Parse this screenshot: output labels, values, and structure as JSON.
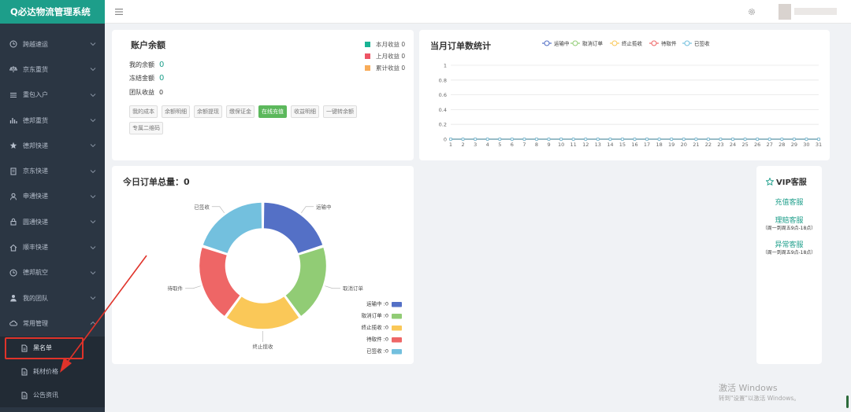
{
  "app": {
    "title": "Q必达物流管理系统"
  },
  "sidebar": {
    "items": [
      {
        "label": "跨越速运",
        "icon": "clock-icon"
      },
      {
        "label": "京东重货",
        "icon": "scale-icon"
      },
      {
        "label": "重包入户",
        "icon": "list-icon"
      },
      {
        "label": "德邦重货",
        "icon": "bar-chart-icon"
      },
      {
        "label": "德邦快递",
        "icon": "star-icon"
      },
      {
        "label": "京东快递",
        "icon": "document-icon"
      },
      {
        "label": "申通快递",
        "icon": "user-icon"
      },
      {
        "label": "圆通快递",
        "icon": "lock-icon"
      },
      {
        "label": "顺丰快递",
        "icon": "home-icon"
      },
      {
        "label": "德邦航空",
        "icon": "clock-icon"
      },
      {
        "label": "我的团队",
        "icon": "team-icon"
      },
      {
        "label": "常用管理",
        "icon": "cloud-icon"
      }
    ],
    "subitems": [
      {
        "label": "黑名单",
        "icon": "file-icon"
      },
      {
        "label": "耗材价格",
        "icon": "file-icon"
      },
      {
        "label": "公告资讯",
        "icon": "file-icon"
      }
    ]
  },
  "account": {
    "title": "账户余额",
    "rows": [
      {
        "label": "我的余额",
        "value": "0"
      },
      {
        "label": "冻结金额",
        "value": "0"
      },
      {
        "label": "团队收益",
        "value": "0"
      }
    ],
    "legend": [
      {
        "label": "本月收益 0",
        "color": "#1ab394"
      },
      {
        "label": "上月收益 0",
        "color": "#ed5565"
      },
      {
        "label": "累计收益 0",
        "color": "#f8ac59"
      }
    ],
    "buttons_row1": [
      "我的成本",
      "余额明细",
      "余额提现",
      "缴保证金",
      "在线充值",
      "收益明细",
      "一键转余额"
    ],
    "buttons_row2": [
      "专属二维码"
    ]
  },
  "monthly": {
    "title": "当月订单数统计"
  },
  "today": {
    "title": "今日订单总量：0"
  },
  "chart_data": [
    {
      "type": "line",
      "title": "当月订单数统计",
      "x": [
        "1",
        "2",
        "3",
        "4",
        "5",
        "6",
        "7",
        "8",
        "9",
        "10",
        "11",
        "12",
        "13",
        "14",
        "15",
        "16",
        "17",
        "18",
        "19",
        "20",
        "21",
        "22",
        "23",
        "24",
        "25",
        "26",
        "27",
        "28",
        "29",
        "30",
        "31"
      ],
      "ylim": [
        0,
        1
      ],
      "yticks": [
        "0",
        "0.2",
        "0.4",
        "0.6",
        "0.8",
        "1"
      ],
      "grid": true,
      "legend_position": "top",
      "series": [
        {
          "name": "运输中",
          "color": "#5470c6",
          "values": [
            0,
            0,
            0,
            0,
            0,
            0,
            0,
            0,
            0,
            0,
            0,
            0,
            0,
            0,
            0,
            0,
            0,
            0,
            0,
            0,
            0,
            0,
            0,
            0,
            0,
            0,
            0,
            0,
            0,
            0,
            0
          ]
        },
        {
          "name": "取消订单",
          "color": "#91cc75",
          "values": [
            0,
            0,
            0,
            0,
            0,
            0,
            0,
            0,
            0,
            0,
            0,
            0,
            0,
            0,
            0,
            0,
            0,
            0,
            0,
            0,
            0,
            0,
            0,
            0,
            0,
            0,
            0,
            0,
            0,
            0,
            0
          ]
        },
        {
          "name": "终止揽收",
          "color": "#fac858",
          "values": [
            0,
            0,
            0,
            0,
            0,
            0,
            0,
            0,
            0,
            0,
            0,
            0,
            0,
            0,
            0,
            0,
            0,
            0,
            0,
            0,
            0,
            0,
            0,
            0,
            0,
            0,
            0,
            0,
            0,
            0,
            0
          ]
        },
        {
          "name": "待取件",
          "color": "#ee6666",
          "values": [
            0,
            0,
            0,
            0,
            0,
            0,
            0,
            0,
            0,
            0,
            0,
            0,
            0,
            0,
            0,
            0,
            0,
            0,
            0,
            0,
            0,
            0,
            0,
            0,
            0,
            0,
            0,
            0,
            0,
            0,
            0
          ]
        },
        {
          "name": "已签收",
          "color": "#73c0de",
          "values": [
            0,
            0,
            0,
            0,
            0,
            0,
            0,
            0,
            0,
            0,
            0,
            0,
            0,
            0,
            0,
            0,
            0,
            0,
            0,
            0,
            0,
            0,
            0,
            0,
            0,
            0,
            0,
            0,
            0,
            0,
            0
          ]
        }
      ]
    },
    {
      "type": "pie",
      "title": "今日订单总量：0",
      "donut": true,
      "legend_position": "bottom-right",
      "slices": [
        {
          "name": "运输中",
          "value": 0,
          "legend": "运输中 :0",
          "color": "#5470c6"
        },
        {
          "name": "取消订单",
          "value": 0,
          "legend": "取消订单 :0",
          "color": "#91cc75"
        },
        {
          "name": "终止揽收",
          "value": 0,
          "legend": "终止揽收 :0",
          "color": "#fac858"
        },
        {
          "name": "待取件",
          "value": 0,
          "legend": "待取件 :0",
          "color": "#ee6666"
        },
        {
          "name": "已签收",
          "value": 0,
          "legend": "已签收 :0",
          "color": "#73c0de"
        }
      ]
    }
  ],
  "vip": {
    "title": "VIP客服",
    "links": [
      {
        "label": "充值客服",
        "note": ""
      },
      {
        "label": "理赔客服",
        "note": "（周一到周五9点-18点）"
      },
      {
        "label": "异常客服",
        "note": "（周一到周五9点-18点）"
      }
    ]
  },
  "watermark": {
    "title": "激活 Windows",
    "subtitle": "转到\"设置\"以激活 Windows。"
  },
  "colors": {
    "brand": "#1d9e8a",
    "sidebar_bg": "#2b3643",
    "highlight": "#e0332a"
  }
}
